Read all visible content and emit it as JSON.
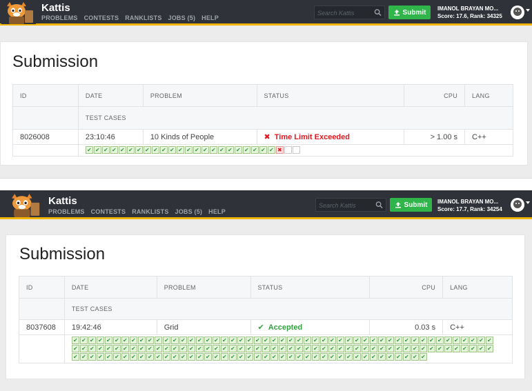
{
  "screens": [
    {
      "navbar": {
        "brand": "Kattis",
        "links": [
          "PROBLEMS",
          "CONTESTS",
          "RANKLISTS",
          "JOBS (5)",
          "HELP"
        ],
        "search_placeholder": "Search Kattis",
        "submit_label": "Submit",
        "user_name": "IMANOL BRAYAN MO...",
        "user_stats": "Score: 17.6, Rank: 34325"
      },
      "page_title": "Submission",
      "table": {
        "headers": [
          "ID",
          "DATE",
          "PROBLEM",
          "STATUS",
          "CPU",
          "LANG"
        ],
        "subheader": "TEST CASES",
        "row": {
          "id": "8026008",
          "date": "23:10:46",
          "problem": "10 Kinds of People",
          "status": "Time Limit Exceeded",
          "cpu": "> 1.00 s",
          "lang": "C++"
        },
        "test_cases": {
          "accepted": 23,
          "failed": 1,
          "not_run": 2
        }
      },
      "colors": {
        "status": "#e0171f"
      }
    },
    {
      "navbar": {
        "brand": "Kattis",
        "links": [
          "PROBLEMS",
          "CONTESTS",
          "RANKLISTS",
          "JOBS (5)",
          "HELP"
        ],
        "search_placeholder": "Search Kattis",
        "submit_label": "Submit",
        "user_name": "IMANOL BRAYAN MO...",
        "user_stats": "Score: 17.7, Rank: 34254"
      },
      "page_title": "Submission",
      "table": {
        "headers": [
          "ID",
          "DATE",
          "PROBLEM",
          "STATUS",
          "CPU",
          "LANG"
        ],
        "subheader": "TEST CASES",
        "row": {
          "id": "8037608",
          "date": "19:42:46",
          "problem": "Grid",
          "status": "Accepted",
          "cpu": "0.03 s",
          "lang": "C++"
        },
        "test_cases": {
          "accepted": 145,
          "failed": 0,
          "not_run": 0
        }
      },
      "colors": {
        "status": "#2fa23e"
      }
    }
  ],
  "colors": {
    "navbar": "#2f3238",
    "accent": "#f1b400",
    "submit": "#2fb54a",
    "link": "#3c80c4"
  },
  "icons": {
    "logo": "kattis-cat-logo",
    "search": "search-icon",
    "upload": "upload-icon",
    "avatar": "avatar-icon",
    "caret": "caret-down-icon",
    "tle": "x-mark-icon",
    "ac": "check-icon"
  }
}
